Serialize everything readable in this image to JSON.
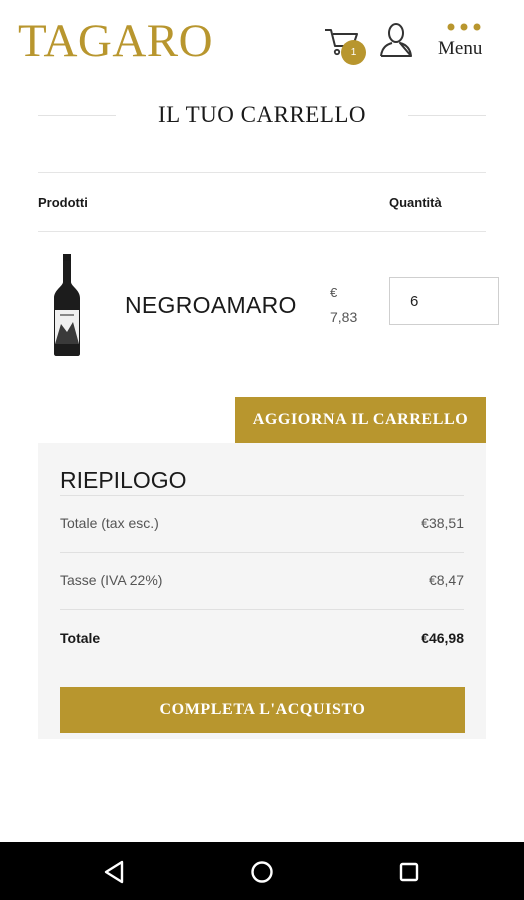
{
  "header": {
    "logo": "TAGARO",
    "cart_count": "1",
    "menu_label": "Menu",
    "icons": [
      "cart-icon",
      "user-icon",
      "menu-dots-icon"
    ]
  },
  "page": {
    "title": "IL TUO CARRELLO"
  },
  "table": {
    "col_products": "Prodotti",
    "col_quantity": "Quantità"
  },
  "product": {
    "name": "NEGROAMARO",
    "price_currency": "€",
    "price_value": "7,83",
    "quantity": "6"
  },
  "actions": {
    "update_cart": "AGGIORNA IL CARRELLO",
    "checkout": "COMPLETA L'ACQUISTO"
  },
  "summary": {
    "title": "RIEPILOGO",
    "rows": [
      {
        "label": "Totale (tax esc.)",
        "value": "€38,51"
      },
      {
        "label": "Tasse (IVA 22%)",
        "value": "€8,47"
      },
      {
        "label": "Totale",
        "value": "€46,98"
      }
    ]
  },
  "colors": {
    "accent": "#b8962e",
    "panel": "#f5f5f5",
    "navbar": "#000000"
  }
}
